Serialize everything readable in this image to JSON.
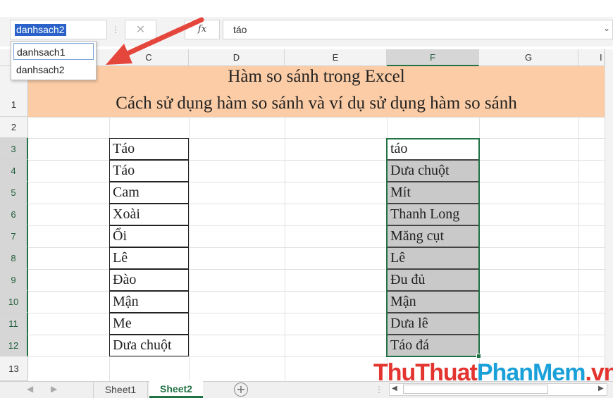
{
  "name_box": {
    "value": "danhsach2"
  },
  "formula_bar": {
    "fx_label": "fx",
    "cancel_symbol": "✕",
    "value": "táo",
    "expand_symbol": "⌄"
  },
  "name_dropdown": {
    "items": [
      "danhsach1",
      "danhsach2"
    ],
    "highlighted": "danhsach1"
  },
  "columns": [
    "C",
    "D",
    "E",
    "F",
    "G",
    "I"
  ],
  "selected_column": "F",
  "rows": [
    "1",
    "2",
    "3",
    "4",
    "5",
    "6",
    "7",
    "8",
    "9",
    "10",
    "11",
    "12",
    "13"
  ],
  "selected_rows_range": [
    "3",
    "12"
  ],
  "title": {
    "line1": "Hàm so sánh trong Excel",
    "line2": "Cách sử dụng hàm so sánh và ví dụ sử dụng hàm so sánh",
    "fill_color": "#fbcca5"
  },
  "column_c": [
    "Táo",
    "Táo",
    "Cam",
    "Xoài",
    "Ổi",
    "Lê",
    "Đào",
    "Mận",
    "Me",
    "Dưa chuột"
  ],
  "column_f": [
    "táo",
    "Dưa chuột",
    "Mít",
    "Thanh Long",
    "Măng cụt",
    "Lê",
    "Đu đủ",
    "Mận",
    "Dưa lê",
    "Táo đá"
  ],
  "active_cell_value": "táo",
  "sheet_tabs": {
    "items": [
      "Sheet1",
      "Sheet2"
    ],
    "active": "Sheet2",
    "add_symbol": "+"
  },
  "watermark": {
    "part1": "ThuThuat",
    "part2": "PhanMem",
    "part3": ".vn"
  },
  "colors": {
    "accent": "#217346",
    "arrow": "#e5463c",
    "selection_fill": "#c9c9c9",
    "namebox_highlight": "#2a62c9"
  }
}
